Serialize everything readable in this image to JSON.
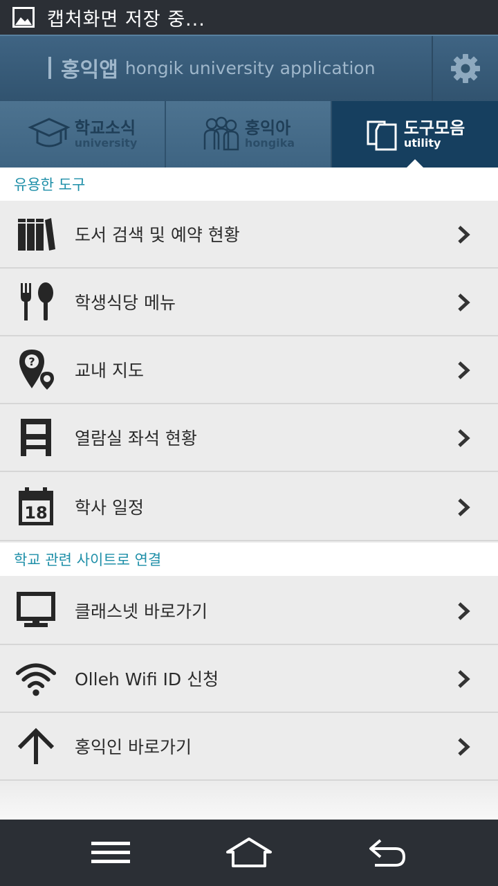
{
  "status_bar": {
    "title": "캡처화면 저장 중..."
  },
  "header": {
    "brand_ko": "홍익앱",
    "brand_en": "hongik university application"
  },
  "tabs": [
    {
      "ko": "학교소식",
      "en": "university",
      "active": false
    },
    {
      "ko": "홍익아",
      "en": "hongika",
      "active": false
    },
    {
      "ko": "도구모음",
      "en": "utility",
      "active": true
    }
  ],
  "sections": [
    {
      "title": "유용한 도구",
      "items": [
        {
          "label": "도서 검색 및 예약 현황",
          "icon": "books-icon"
        },
        {
          "label": "학생식당 메뉴",
          "icon": "fork-spoon-icon"
        },
        {
          "label": "교내 지도",
          "icon": "map-pin-icon"
        },
        {
          "label": "열람실 좌석 현황",
          "icon": "seat-icon"
        },
        {
          "label": "학사 일정",
          "icon": "calendar-icon",
          "calendar_day": "18"
        }
      ]
    },
    {
      "title": "학교 관련 사이트로 연결",
      "items": [
        {
          "label": "클래스넷 바로가기",
          "icon": "monitor-icon"
        },
        {
          "label": "Olleh Wifi ID 신청",
          "icon": "wifi-icon"
        },
        {
          "label": "홍익인 바로가기",
          "icon": "arrow-up-icon"
        }
      ]
    }
  ],
  "colors": {
    "header": "#3f6483",
    "active_tab": "#163f5f",
    "section_text": "#1e8fa8",
    "row_bg": "#ececec",
    "system_bar": "#2b2f35"
  }
}
